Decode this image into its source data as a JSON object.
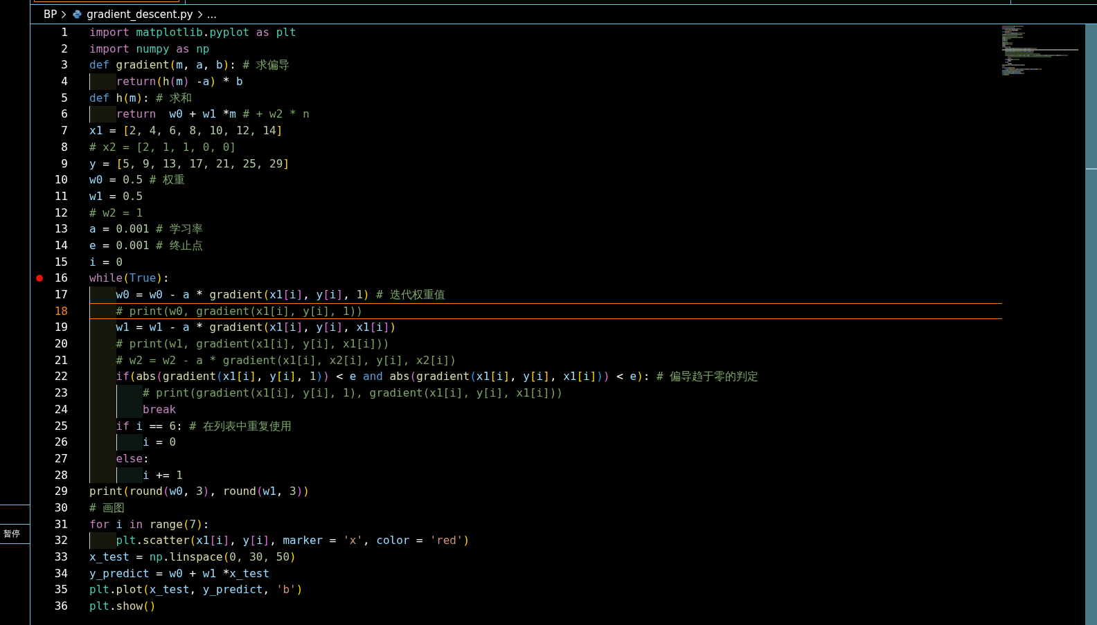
{
  "side_panel": {
    "label": "暂停"
  },
  "breadcrumb": [
    {
      "text": "BP",
      "kind": "folder"
    },
    {
      "text": "gradient_descent.py",
      "kind": "file"
    },
    {
      "text": "...",
      "kind": "more"
    }
  ],
  "lines": [
    {
      "number": "1",
      "breakpoint": false,
      "current": false,
      "code": [
        {
          "text": "import ",
          "kind": "keyword"
        },
        {
          "text": "matplotlib",
          "kind": "module"
        },
        {
          "text": ".",
          "kind": "plain"
        },
        {
          "text": "pyplot",
          "kind": "module"
        },
        {
          "text": " as ",
          "kind": "keyword"
        },
        {
          "text": "plt",
          "kind": "module"
        }
      ]
    },
    {
      "number": "2",
      "breakpoint": false,
      "current": false,
      "code": [
        {
          "text": "import ",
          "kind": "keyword"
        },
        {
          "text": "numpy",
          "kind": "module"
        },
        {
          "text": " as ",
          "kind": "keyword"
        },
        {
          "text": "np",
          "kind": "module"
        }
      ]
    },
    {
      "number": "3",
      "breakpoint": false,
      "current": false,
      "code": [
        {
          "text": "def ",
          "kind": "storage"
        },
        {
          "text": "gradient",
          "kind": "func"
        },
        {
          "text": "(",
          "kind": "b1"
        },
        {
          "text": "m",
          "kind": "var"
        },
        {
          "text": ", ",
          "kind": "plain"
        },
        {
          "text": "a",
          "kind": "var"
        },
        {
          "text": ", ",
          "kind": "plain"
        },
        {
          "text": "b",
          "kind": "var"
        },
        {
          "text": ")",
          "kind": "b1"
        },
        {
          "text": ": ",
          "kind": "plain"
        },
        {
          "text": "# 求偏导",
          "kind": "comment"
        }
      ]
    },
    {
      "number": "4",
      "breakpoint": false,
      "current": false,
      "code": [
        {
          "kind": "indent"
        },
        {
          "text": "return",
          "kind": "keyword"
        },
        {
          "text": "(",
          "kind": "b1"
        },
        {
          "text": "h",
          "kind": "func"
        },
        {
          "text": "(",
          "kind": "b2"
        },
        {
          "text": "m",
          "kind": "var"
        },
        {
          "text": ")",
          "kind": "b2"
        },
        {
          "text": " -",
          "kind": "plain"
        },
        {
          "text": "a",
          "kind": "var"
        },
        {
          "text": ")",
          "kind": "b1"
        },
        {
          "text": " * ",
          "kind": "plain"
        },
        {
          "text": "b",
          "kind": "var"
        }
      ]
    },
    {
      "number": "5",
      "breakpoint": false,
      "current": false,
      "code": [
        {
          "text": "def ",
          "kind": "storage"
        },
        {
          "text": "h",
          "kind": "func"
        },
        {
          "text": "(",
          "kind": "b1"
        },
        {
          "text": "m",
          "kind": "var"
        },
        {
          "text": ")",
          "kind": "b1"
        },
        {
          "text": ": ",
          "kind": "plain"
        },
        {
          "text": "# 求和",
          "kind": "comment"
        }
      ]
    },
    {
      "number": "6",
      "breakpoint": false,
      "current": false,
      "code": [
        {
          "kind": "indent"
        },
        {
          "text": "return  ",
          "kind": "keyword"
        },
        {
          "text": "w0",
          "kind": "var"
        },
        {
          "text": " + ",
          "kind": "plain"
        },
        {
          "text": "w1",
          "kind": "var"
        },
        {
          "text": " *",
          "kind": "plain"
        },
        {
          "text": "m",
          "kind": "var"
        },
        {
          "text": " # + w2 * n",
          "kind": "comment"
        }
      ]
    },
    {
      "number": "7",
      "breakpoint": false,
      "current": false,
      "code": [
        {
          "text": "x1",
          "kind": "var"
        },
        {
          "text": " = ",
          "kind": "plain"
        },
        {
          "text": "[",
          "kind": "b1"
        },
        {
          "text": "2, 4, 6, 8, 10, 12, 14",
          "kind": "num"
        },
        {
          "text": "]",
          "kind": "b1"
        }
      ]
    },
    {
      "number": "8",
      "breakpoint": false,
      "current": false,
      "code": [
        {
          "text": "# x2 = [2, 1, 1, 0, 0]",
          "kind": "comment"
        }
      ]
    },
    {
      "number": "9",
      "breakpoint": false,
      "current": false,
      "code": [
        {
          "text": "y",
          "kind": "var"
        },
        {
          "text": " = ",
          "kind": "plain"
        },
        {
          "text": "[",
          "kind": "b1"
        },
        {
          "text": "5, 9, 13, 17, 21, 25, 29",
          "kind": "num"
        },
        {
          "text": "]",
          "kind": "b1"
        }
      ]
    },
    {
      "number": "10",
      "breakpoint": false,
      "current": false,
      "code": [
        {
          "text": "w0",
          "kind": "var"
        },
        {
          "text": " = ",
          "kind": "plain"
        },
        {
          "text": "0.5",
          "kind": "num"
        },
        {
          "text": " # 权重",
          "kind": "comment"
        }
      ]
    },
    {
      "number": "11",
      "breakpoint": false,
      "current": false,
      "code": [
        {
          "text": "w1",
          "kind": "var"
        },
        {
          "text": " = ",
          "kind": "plain"
        },
        {
          "text": "0.5",
          "kind": "num"
        }
      ]
    },
    {
      "number": "12",
      "breakpoint": false,
      "current": false,
      "code": [
        {
          "text": "# w2 = 1",
          "kind": "comment"
        }
      ]
    },
    {
      "number": "13",
      "breakpoint": false,
      "current": false,
      "code": [
        {
          "text": "a",
          "kind": "var"
        },
        {
          "text": " = ",
          "kind": "plain"
        },
        {
          "text": "0.001",
          "kind": "num"
        },
        {
          "text": " # 学习率",
          "kind": "comment"
        }
      ]
    },
    {
      "number": "14",
      "breakpoint": false,
      "current": false,
      "code": [
        {
          "text": "e",
          "kind": "var"
        },
        {
          "text": " = ",
          "kind": "plain"
        },
        {
          "text": "0.001",
          "kind": "num"
        },
        {
          "text": " # 终止点",
          "kind": "comment"
        }
      ]
    },
    {
      "number": "15",
      "breakpoint": false,
      "current": false,
      "code": [
        {
          "text": "i",
          "kind": "var"
        },
        {
          "text": " = ",
          "kind": "plain"
        },
        {
          "text": "0",
          "kind": "num"
        }
      ]
    },
    {
      "number": "16",
      "breakpoint": true,
      "current": false,
      "code": [
        {
          "text": "while",
          "kind": "keyword"
        },
        {
          "text": "(",
          "kind": "b1"
        },
        {
          "text": "True",
          "kind": "storage"
        },
        {
          "text": ")",
          "kind": "b1"
        },
        {
          "text": ":",
          "kind": "plain"
        }
      ]
    },
    {
      "number": "17",
      "breakpoint": false,
      "current": false,
      "code": [
        {
          "kind": "indent"
        },
        {
          "text": "w0",
          "kind": "var"
        },
        {
          "text": " = ",
          "kind": "plain"
        },
        {
          "text": "w0",
          "kind": "var"
        },
        {
          "text": " - ",
          "kind": "plain"
        },
        {
          "text": "a",
          "kind": "var"
        },
        {
          "text": " * ",
          "kind": "plain"
        },
        {
          "text": "gradient",
          "kind": "func"
        },
        {
          "text": "(",
          "kind": "b1"
        },
        {
          "text": "x1",
          "kind": "var"
        },
        {
          "text": "[",
          "kind": "b2"
        },
        {
          "text": "i",
          "kind": "var"
        },
        {
          "text": "]",
          "kind": "b2"
        },
        {
          "text": ", ",
          "kind": "plain"
        },
        {
          "text": "y",
          "kind": "var"
        },
        {
          "text": "[",
          "kind": "b2"
        },
        {
          "text": "i",
          "kind": "var"
        },
        {
          "text": "]",
          "kind": "b2"
        },
        {
          "text": ", ",
          "kind": "plain"
        },
        {
          "text": "1",
          "kind": "num"
        },
        {
          "text": ")",
          "kind": "b1"
        },
        {
          "text": " # 迭代权重值",
          "kind": "comment"
        }
      ]
    },
    {
      "number": "18",
      "breakpoint": false,
      "current": true,
      "code": [
        {
          "kind": "indent"
        },
        {
          "text": "# print(w0, gradient(x1[i], y[i], 1))",
          "kind": "comment"
        }
      ]
    },
    {
      "number": "19",
      "breakpoint": false,
      "current": false,
      "code": [
        {
          "kind": "indent"
        },
        {
          "text": "w1",
          "kind": "var"
        },
        {
          "text": " = ",
          "kind": "plain"
        },
        {
          "text": "w1",
          "kind": "var"
        },
        {
          "text": " - ",
          "kind": "plain"
        },
        {
          "text": "a",
          "kind": "var"
        },
        {
          "text": " * ",
          "kind": "plain"
        },
        {
          "text": "gradient",
          "kind": "func"
        },
        {
          "text": "(",
          "kind": "b1"
        },
        {
          "text": "x1",
          "kind": "var"
        },
        {
          "text": "[",
          "kind": "b2"
        },
        {
          "text": "i",
          "kind": "var"
        },
        {
          "text": "]",
          "kind": "b2"
        },
        {
          "text": ", ",
          "kind": "plain"
        },
        {
          "text": "y",
          "kind": "var"
        },
        {
          "text": "[",
          "kind": "b2"
        },
        {
          "text": "i",
          "kind": "var"
        },
        {
          "text": "]",
          "kind": "b2"
        },
        {
          "text": ", ",
          "kind": "plain"
        },
        {
          "text": "x1",
          "kind": "var"
        },
        {
          "text": "[",
          "kind": "b2"
        },
        {
          "text": "i",
          "kind": "var"
        },
        {
          "text": "]",
          "kind": "b2"
        },
        {
          "text": ")",
          "kind": "b1"
        }
      ]
    },
    {
      "number": "20",
      "breakpoint": false,
      "current": false,
      "code": [
        {
          "kind": "indent"
        },
        {
          "text": "# print(w1, gradient(x1[i], y[i], x1[i]))",
          "kind": "comment"
        }
      ]
    },
    {
      "number": "21",
      "breakpoint": false,
      "current": false,
      "code": [
        {
          "kind": "indent"
        },
        {
          "text": "# w2 = w2 - a * gradient(x1[i], x2[i], y[i], x2[i])",
          "kind": "comment"
        }
      ]
    },
    {
      "number": "22",
      "breakpoint": false,
      "current": false,
      "code": [
        {
          "kind": "indent"
        },
        {
          "text": "if",
          "kind": "keyword"
        },
        {
          "text": "(",
          "kind": "b1"
        },
        {
          "text": "abs",
          "kind": "func"
        },
        {
          "text": "(",
          "kind": "b2"
        },
        {
          "text": "gradient",
          "kind": "func"
        },
        {
          "text": "(",
          "kind": "b3"
        },
        {
          "text": "x1",
          "kind": "var"
        },
        {
          "text": "[",
          "kind": "b1"
        },
        {
          "text": "i",
          "kind": "var"
        },
        {
          "text": "]",
          "kind": "b1"
        },
        {
          "text": ", ",
          "kind": "plain"
        },
        {
          "text": "y",
          "kind": "var"
        },
        {
          "text": "[",
          "kind": "b1"
        },
        {
          "text": "i",
          "kind": "var"
        },
        {
          "text": "]",
          "kind": "b1"
        },
        {
          "text": ", ",
          "kind": "plain"
        },
        {
          "text": "1",
          "kind": "num"
        },
        {
          "text": ")",
          "kind": "b3"
        },
        {
          "text": ")",
          "kind": "b2"
        },
        {
          "text": " < ",
          "kind": "plain"
        },
        {
          "text": "e",
          "kind": "var"
        },
        {
          "text": " and ",
          "kind": "storage"
        },
        {
          "text": "abs",
          "kind": "func"
        },
        {
          "text": "(",
          "kind": "b2"
        },
        {
          "text": "gradient",
          "kind": "func"
        },
        {
          "text": "(",
          "kind": "b3"
        },
        {
          "text": "x1",
          "kind": "var"
        },
        {
          "text": "[",
          "kind": "b1"
        },
        {
          "text": "i",
          "kind": "var"
        },
        {
          "text": "]",
          "kind": "b1"
        },
        {
          "text": ", ",
          "kind": "plain"
        },
        {
          "text": "y",
          "kind": "var"
        },
        {
          "text": "[",
          "kind": "b1"
        },
        {
          "text": "i",
          "kind": "var"
        },
        {
          "text": "]",
          "kind": "b1"
        },
        {
          "text": ", ",
          "kind": "plain"
        },
        {
          "text": "x1",
          "kind": "var"
        },
        {
          "text": "[",
          "kind": "b1"
        },
        {
          "text": "i",
          "kind": "var"
        },
        {
          "text": "]",
          "kind": "b1"
        },
        {
          "text": ")",
          "kind": "b3"
        },
        {
          "text": ")",
          "kind": "b2"
        },
        {
          "text": " < ",
          "kind": "plain"
        },
        {
          "text": "e",
          "kind": "var"
        },
        {
          "text": ")",
          "kind": "b1"
        },
        {
          "text": ": ",
          "kind": "plain"
        },
        {
          "text": "# 偏导趋于零的判定",
          "kind": "comment"
        }
      ]
    },
    {
      "number": "23",
      "breakpoint": false,
      "current": false,
      "code": [
        {
          "kind": "indent"
        },
        {
          "kind": "indent"
        },
        {
          "text": "# print(gradient(x1[i], y[i], 1), gradient(x1[i], y[i], x1[i]))",
          "kind": "comment"
        }
      ]
    },
    {
      "number": "24",
      "breakpoint": false,
      "current": false,
      "code": [
        {
          "kind": "indent"
        },
        {
          "kind": "indent"
        },
        {
          "text": "break",
          "kind": "keyword"
        }
      ]
    },
    {
      "number": "25",
      "breakpoint": false,
      "current": false,
      "code": [
        {
          "kind": "indent"
        },
        {
          "text": "if ",
          "kind": "keyword"
        },
        {
          "text": "i",
          "kind": "var"
        },
        {
          "text": " == ",
          "kind": "plain"
        },
        {
          "text": "6",
          "kind": "num"
        },
        {
          "text": ": ",
          "kind": "plain"
        },
        {
          "text": "# 在列表中重复使用",
          "kind": "comment"
        }
      ]
    },
    {
      "number": "26",
      "breakpoint": false,
      "current": false,
      "code": [
        {
          "kind": "indent"
        },
        {
          "kind": "indent"
        },
        {
          "text": "i",
          "kind": "var"
        },
        {
          "text": " = ",
          "kind": "plain"
        },
        {
          "text": "0",
          "kind": "num"
        }
      ]
    },
    {
      "number": "27",
      "breakpoint": false,
      "current": false,
      "code": [
        {
          "kind": "indent"
        },
        {
          "text": "else",
          "kind": "keyword"
        },
        {
          "text": ":",
          "kind": "plain"
        }
      ]
    },
    {
      "number": "28",
      "breakpoint": false,
      "current": false,
      "code": [
        {
          "kind": "indent"
        },
        {
          "kind": "indent"
        },
        {
          "text": "i",
          "kind": "var"
        },
        {
          "text": " += ",
          "kind": "plain"
        },
        {
          "text": "1",
          "kind": "num"
        }
      ]
    },
    {
      "number": "29",
      "breakpoint": false,
      "current": false,
      "code": [
        {
          "text": "print",
          "kind": "func"
        },
        {
          "text": "(",
          "kind": "b1"
        },
        {
          "text": "round",
          "kind": "func"
        },
        {
          "text": "(",
          "kind": "b2"
        },
        {
          "text": "w0",
          "kind": "var"
        },
        {
          "text": ", ",
          "kind": "plain"
        },
        {
          "text": "3",
          "kind": "num"
        },
        {
          "text": ")",
          "kind": "b2"
        },
        {
          "text": ", ",
          "kind": "plain"
        },
        {
          "text": "round",
          "kind": "func"
        },
        {
          "text": "(",
          "kind": "b2"
        },
        {
          "text": "w1",
          "kind": "var"
        },
        {
          "text": ", ",
          "kind": "plain"
        },
        {
          "text": "3",
          "kind": "num"
        },
        {
          "text": ")",
          "kind": "b2"
        },
        {
          "text": ")",
          "kind": "b1"
        }
      ]
    },
    {
      "number": "30",
      "breakpoint": false,
      "current": false,
      "code": [
        {
          "text": "# 画图",
          "kind": "comment"
        }
      ]
    },
    {
      "number": "31",
      "breakpoint": false,
      "current": false,
      "code": [
        {
          "text": "for ",
          "kind": "keyword"
        },
        {
          "text": "i",
          "kind": "var"
        },
        {
          "text": " in ",
          "kind": "keyword"
        },
        {
          "text": "range",
          "kind": "func"
        },
        {
          "text": "(",
          "kind": "b1"
        },
        {
          "text": "7",
          "kind": "num"
        },
        {
          "text": ")",
          "kind": "b1"
        },
        {
          "text": ":",
          "kind": "plain"
        }
      ]
    },
    {
      "number": "32",
      "breakpoint": false,
      "current": false,
      "code": [
        {
          "kind": "indent"
        },
        {
          "text": "plt",
          "kind": "module"
        },
        {
          "text": ".",
          "kind": "plain"
        },
        {
          "text": "scatter",
          "kind": "func"
        },
        {
          "text": "(",
          "kind": "b1"
        },
        {
          "text": "x1",
          "kind": "var"
        },
        {
          "text": "[",
          "kind": "b2"
        },
        {
          "text": "i",
          "kind": "var"
        },
        {
          "text": "]",
          "kind": "b2"
        },
        {
          "text": ", ",
          "kind": "plain"
        },
        {
          "text": "y",
          "kind": "var"
        },
        {
          "text": "[",
          "kind": "b2"
        },
        {
          "text": "i",
          "kind": "var"
        },
        {
          "text": "]",
          "kind": "b2"
        },
        {
          "text": ", ",
          "kind": "plain"
        },
        {
          "text": "marker",
          "kind": "var"
        },
        {
          "text": " = ",
          "kind": "plain"
        },
        {
          "text": "'x'",
          "kind": "str"
        },
        {
          "text": ", ",
          "kind": "plain"
        },
        {
          "text": "color",
          "kind": "var"
        },
        {
          "text": " = ",
          "kind": "plain"
        },
        {
          "text": "'red'",
          "kind": "str"
        },
        {
          "text": ")",
          "kind": "b1"
        }
      ]
    },
    {
      "number": "33",
      "breakpoint": false,
      "current": false,
      "code": [
        {
          "text": "x_test",
          "kind": "var"
        },
        {
          "text": " = ",
          "kind": "plain"
        },
        {
          "text": "np",
          "kind": "module"
        },
        {
          "text": ".",
          "kind": "plain"
        },
        {
          "text": "linspace",
          "kind": "func"
        },
        {
          "text": "(",
          "kind": "b1"
        },
        {
          "text": "0, 30, 50",
          "kind": "num"
        },
        {
          "text": ")",
          "kind": "b1"
        }
      ]
    },
    {
      "number": "34",
      "breakpoint": false,
      "current": false,
      "code": [
        {
          "text": "y_predict",
          "kind": "var"
        },
        {
          "text": " = ",
          "kind": "plain"
        },
        {
          "text": "w0",
          "kind": "var"
        },
        {
          "text": " + ",
          "kind": "plain"
        },
        {
          "text": "w1",
          "kind": "var"
        },
        {
          "text": " *",
          "kind": "plain"
        },
        {
          "text": "x_test",
          "kind": "var"
        }
      ]
    },
    {
      "number": "35",
      "breakpoint": false,
      "current": false,
      "code": [
        {
          "text": "plt",
          "kind": "module"
        },
        {
          "text": ".",
          "kind": "plain"
        },
        {
          "text": "plot",
          "kind": "func"
        },
        {
          "text": "(",
          "kind": "b1"
        },
        {
          "text": "x_test",
          "kind": "var"
        },
        {
          "text": ", ",
          "kind": "plain"
        },
        {
          "text": "y_predict",
          "kind": "var"
        },
        {
          "text": ", ",
          "kind": "plain"
        },
        {
          "text": "'b'",
          "kind": "str"
        },
        {
          "text": ")",
          "kind": "b1"
        }
      ]
    },
    {
      "number": "36",
      "breakpoint": false,
      "current": false,
      "code": [
        {
          "text": "plt",
          "kind": "module"
        },
        {
          "text": ".",
          "kind": "plain"
        },
        {
          "text": "show",
          "kind": "func"
        },
        {
          "text": "(",
          "kind": "b1"
        },
        {
          "text": ")",
          "kind": "b1"
        }
      ]
    }
  ]
}
